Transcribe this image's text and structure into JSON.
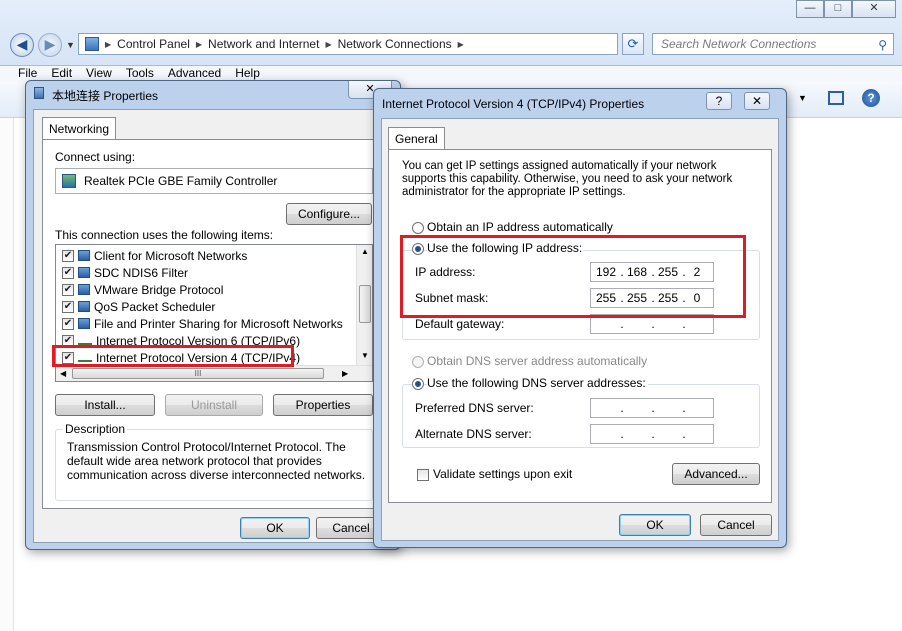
{
  "explorer": {
    "address": {
      "segments": [
        "Control Panel",
        "Network and Internet",
        "Network Connections"
      ],
      "separator": "▶"
    },
    "search_placeholder": "Search Network Connections",
    "menu": [
      "File",
      "Edit",
      "View",
      "Tools",
      "Advanced",
      "Help"
    ],
    "caption_buttons": {
      "minimize": "—",
      "maximize": "□",
      "close": "✕"
    }
  },
  "props_dialog": {
    "title": "本地连接 Properties",
    "tab": "Networking",
    "connect_using_label": "Connect using:",
    "adapter": "Realtek PCIe GBE Family Controller",
    "configure_button": "Configure...",
    "items_label": "This connection uses the following items:",
    "items": [
      {
        "label": "Client for Microsoft Networks",
        "checked": true
      },
      {
        "label": "SDC NDIS6 Filter",
        "checked": true
      },
      {
        "label": "VMware Bridge Protocol",
        "checked": true
      },
      {
        "label": "QoS Packet Scheduler",
        "checked": true
      },
      {
        "label": "File and Printer Sharing for Microsoft Networks",
        "checked": true
      },
      {
        "label": "Internet Protocol Version 6 (TCP/IPv6)",
        "checked": true
      },
      {
        "label": "Internet Protocol Version 4 (TCP/IPv4)",
        "checked": true
      }
    ],
    "install_button": "Install...",
    "uninstall_button": "Uninstall",
    "properties_button": "Properties",
    "description_label": "Description",
    "description_text": "Transmission Control Protocol/Internet Protocol. The default wide area network protocol that provides communication across diverse interconnected networks.",
    "ok_button": "OK",
    "cancel_button": "Cancel",
    "hscroll_grip": "III"
  },
  "ipv4_dialog": {
    "title": "Internet Protocol Version 4 (TCP/IPv4) Properties",
    "help_button": "?",
    "close_button": "✕",
    "tab": "General",
    "intro": "You can get IP settings assigned automatically if your network supports this capability. Otherwise, you need to ask your network administrator for the appropriate IP settings.",
    "obtain_ip_auto": "Obtain an IP address automatically",
    "use_following_ip": "Use the following IP address:",
    "ip_address_label": "IP address:",
    "ip_address": [
      "192",
      "168",
      "255",
      "2"
    ],
    "subnet_mask_label": "Subnet mask:",
    "subnet_mask": [
      "255",
      "255",
      "255",
      "0"
    ],
    "default_gateway_label": "Default gateway:",
    "default_gateway": [
      "",
      "",
      "",
      ""
    ],
    "obtain_dns_auto": "Obtain DNS server address automatically",
    "use_following_dns": "Use the following DNS server addresses:",
    "preferred_dns_label": "Preferred DNS server:",
    "preferred_dns": [
      "",
      "",
      "",
      ""
    ],
    "alternate_dns_label": "Alternate DNS server:",
    "alternate_dns": [
      "",
      "",
      "",
      ""
    ],
    "validate_label": "Validate settings upon exit",
    "validate_checked": false,
    "advanced_button": "Advanced...",
    "ok_button": "OK",
    "cancel_button": "Cancel"
  },
  "colors": {
    "highlight": "#e01b24",
    "dialog_frame": "#bcd1ec"
  }
}
